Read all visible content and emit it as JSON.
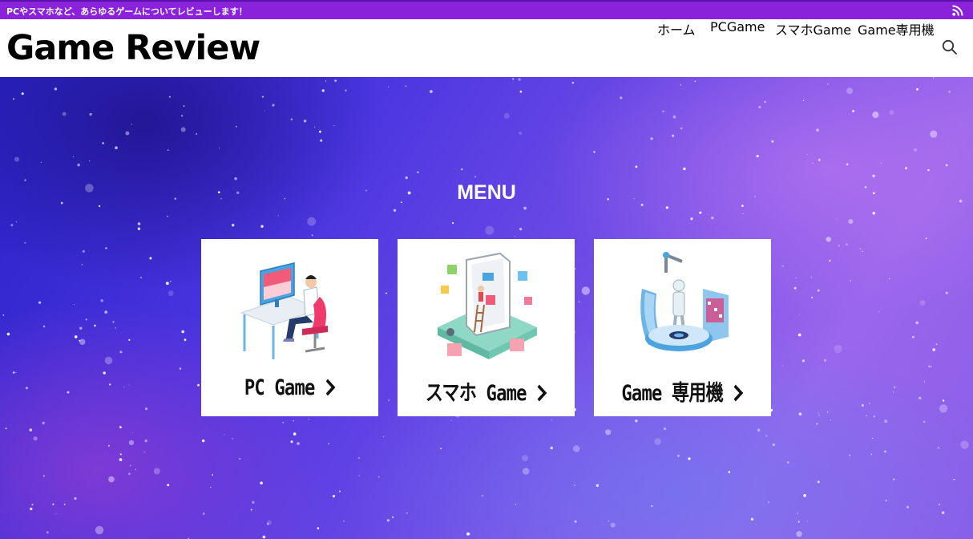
{
  "topbar": {
    "tagline": "PCやスマホなど、あらゆるゲームについてレビューします！",
    "rss_icon": "rss-icon",
    "bg_color": "#8a22dc"
  },
  "header": {
    "logo": "Game Review",
    "nav": [
      {
        "label": "ホーム"
      },
      {
        "label": "PCGame"
      },
      {
        "label": "スマホGame"
      },
      {
        "label": "Game専用機"
      }
    ],
    "search_icon": "search-icon"
  },
  "hero": {
    "title": "MENU",
    "cards": [
      {
        "label": "PC Game",
        "chevron": "chevron-right-icon",
        "illustration": "desk-computer-illustration"
      },
      {
        "label": "スマホ Game",
        "chevron": "chevron-right-icon",
        "illustration": "smartphone-illustration"
      },
      {
        "label": "Game 専用機",
        "chevron": "chevron-right-icon",
        "illustration": "robot-console-illustration"
      }
    ]
  }
}
